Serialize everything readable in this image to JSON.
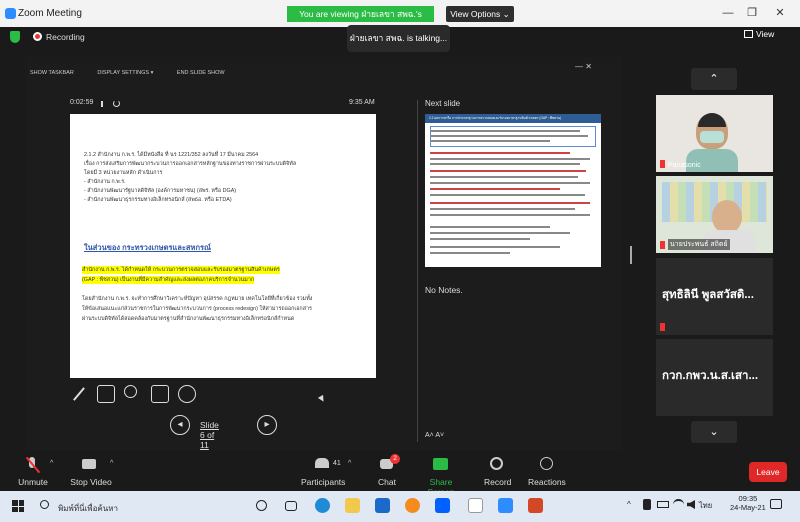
{
  "window": {
    "title": "Zoom Meeting",
    "viewing_banner": "You are viewing ฝ่ายเลขา สพฉ.'s screen",
    "view_options": "View Options ⌄",
    "controls": [
      "—",
      "❐",
      "✕"
    ]
  },
  "meeting": {
    "recording_label": "Recording",
    "talking": "ฝ่ายเลขา สพฉ. is talking...",
    "view_label": "View"
  },
  "share": {
    "toolbar": [
      "SHOW TASKBAR",
      "DISPLAY SETTINGS ▾",
      "END SLIDE SHOW"
    ],
    "window_controls": "—   ✕",
    "timer": "0:02:59",
    "clock": "9:35 AM",
    "next_slide_label": "Next slide",
    "notes": "No Notes.",
    "font_controls": "A˄  A˅",
    "slide_position": "Slide 6 of 11"
  },
  "slide": {
    "lines": [
      "2.1.2 สำนักงาน ก.พ.ร. ได้มีหนังสือ ที่ นร 1221/352 ลงวันที่ 17  มีนาคม 2564",
      "เรื่อง การส่งเสริมการพัฒนากระบวนการออกเอกสารหลักฐานของทางราชการผ่านระบบดิจิทัล",
      "โดยมี 3 หน่วยงานหลัก ดำเนินการ",
      "- สำนักงาน ก.พ.ร.",
      "- สำนักงานพัฒนารัฐบาลดิจิทัล (องค์การมหาชน) (สพร. หรือ DGA)",
      "- สำนักงานพัฒนาธุรกรรมทางอิเล็กทรอนิกส์ (สพธอ. หรือ ETDA)"
    ],
    "heading": "ในส่วนของ กระทรวงเกษตรและสหกรณ์",
    "highlight": [
      "สำนักงาน ก.พ.ร. ได้กำหนดให้  กระบวนการตรวจสอบและรับรองมาตรฐานสินค้าเกษตร",
      "(GAP : พืชสวน) เป็นงานที่มีความสำคัญและส่งผลต่อภาคบริการจำนวนมาก"
    ],
    "body": [
      "โดยสำนักงาน ก.พ.ร. จะทำการศึกษาวิเคราะห์ปัญหา อุปสรรค กฎหมาย เทคโนโลยีที่เกี่ยวข้อง รวมทั้ง",
      "ให้ข้อเสนอแนะแก่ส่วนราชการในการพัฒนากระบวนการ (process redesign) ให้สามารถออกเอกสาร",
      "ผ่านระบบดิจิทัลได้สอดคล้องกับมาตรฐานที่สำนักงานพัฒนาธุรกรรมทางอิเล็กทรอนิกส์กำหนด"
    ]
  },
  "next_slide": {
    "title": "2.2 ผลการหารือ การนำมาตรฐานการตรวจสอบและรับรองมาตรฐานสินค้าเกษตร (GAP : พืชสวน)"
  },
  "gallery": {
    "up": "⌃",
    "down": "⌄",
    "tiles": [
      {
        "name": "Panasonic"
      },
      {
        "name": "นายประพนธ์ สถิตย์"
      },
      {
        "name": "สุทธิลินี พูลสวัสดิ..."
      },
      {
        "name": "กวก.กพว.น.ส.เสา..."
      }
    ]
  },
  "toolbar": {
    "unmute": "Unmute",
    "stop_video": "Stop Video",
    "participants": "Participants",
    "participants_count": "41",
    "chat": "Chat",
    "chat_badge": "2",
    "share_screen": "Share Screen",
    "record": "Record",
    "reactions": "Reactions",
    "leave": "Leave"
  },
  "taskbar": {
    "search_placeholder": "พิมพ์ที่นี่เพื่อค้นหา",
    "lang": "ไทย",
    "time": "09:35",
    "date": "24-May-21"
  },
  "colors": {
    "accent_green": "#2bbc46",
    "leave_red": "#e02828",
    "slide_heading": "#3057a8",
    "highlight": "#ffff00"
  }
}
